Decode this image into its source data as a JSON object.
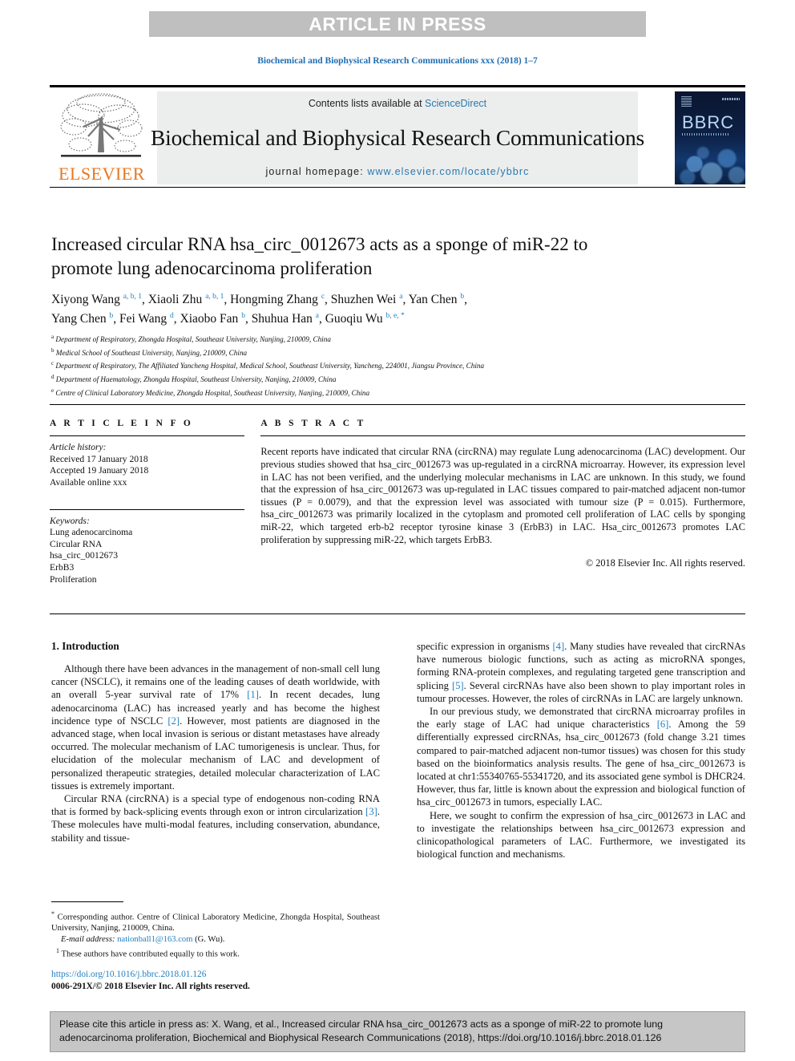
{
  "banner": {
    "text": "ARTICLE IN PRESS"
  },
  "running_head": "Biochemical and Biophysical Research Communications xxx (2018) 1–7",
  "journal_header": {
    "contents_prefix": "Contents lists available at ",
    "sciencedirect": "ScienceDirect",
    "journal_title": "Biochemical and Biophysical Research Communications",
    "homepage_prefix": "journal homepage: ",
    "homepage_url": "www.elsevier.com/locate/ybbrc",
    "elsevier_wordmark": "ELSEVIER",
    "cover_wordmark": "BBRC",
    "accent_link_color": "#2a7ab0",
    "elsevier_orange": "#e87722"
  },
  "article": {
    "title": "Increased circular RNA hsa_circ_0012673 acts as a sponge of miR-22 to promote lung adenocarcinoma proliferation",
    "authors_line_1": "Xiyong Wang ",
    "authors": [
      {
        "name": "Xiyong Wang",
        "marks": "a, b, 1"
      },
      {
        "name": "Xiaoli Zhu",
        "marks": "a, b, 1"
      },
      {
        "name": "Hongming Zhang",
        "marks": "c"
      },
      {
        "name": "Shuzhen Wei",
        "marks": "a"
      },
      {
        "name": "Yan Chen",
        "marks": "b"
      },
      {
        "name": "Yang Chen",
        "marks": "b"
      },
      {
        "name": "Fei Wang",
        "marks": "d"
      },
      {
        "name": "Xiaobo Fan",
        "marks": "b"
      },
      {
        "name": "Shuhua Han",
        "marks": "a"
      },
      {
        "name": "Guoqiu Wu",
        "marks": "b, e, *"
      }
    ],
    "affiliations": [
      {
        "label": "a",
        "text": "Department of Respiratory, Zhongda Hospital, Southeast University, Nanjing, 210009, China"
      },
      {
        "label": "b",
        "text": "Medical School of Southeast University, Nanjing, 210009, China"
      },
      {
        "label": "c",
        "text": "Department of Respiratory, The Affiliated Yancheng Hospital, Medical School, Southeast University, Yancheng, 224001, Jiangsu Province, China"
      },
      {
        "label": "d",
        "text": "Department of Haematology, Zhongda Hospital, Southeast University, Nanjing, 210009, China"
      },
      {
        "label": "e",
        "text": "Centre of Clinical Laboratory Medicine, Zhongda Hospital, Southeast University, Nanjing, 210009, China"
      }
    ]
  },
  "article_info": {
    "heading": "A R T I C L E  I N F O",
    "history_label": "Article history:",
    "history": [
      "Received 17 January 2018",
      "Accepted 19 January 2018",
      "Available online xxx"
    ],
    "keywords_label": "Keywords:",
    "keywords": [
      "Lung adenocarcinoma",
      "Circular RNA",
      "hsa_circ_0012673",
      "ErbB3",
      "Proliferation"
    ]
  },
  "abstract": {
    "heading": "A B S T R A C T",
    "body": "Recent reports have indicated that circular RNA (circRNA) may regulate Lung adenocarcinoma (LAC) development. Our previous studies showed that hsa_circ_0012673 was up-regulated in a circRNA microarray. However, its expression level in LAC has not been verified, and the underlying molecular mechanisms in LAC are unknown. In this study, we found that the expression of hsa_circ_0012673 was up-regulated in LAC tissues compared to pair-matched adjacent non-tumor tissues (P = 0.0079), and that the expression level was associated with tumour size (P = 0.015). Furthermore, hsa_circ_0012673 was primarily localized in the cytoplasm and promoted cell proliferation of LAC cells by sponging miR-22, which targeted erb-b2 receptor tyrosine kinase 3 (ErbB3) in LAC. Hsa_circ_0012673 promotes LAC proliferation by suppressing miR-22, which targets ErbB3.",
    "copyright": "© 2018 Elsevier Inc. All rights reserved."
  },
  "introduction": {
    "heading": "1. Introduction",
    "left_paragraphs": [
      "Although there have been advances in the management of non-small cell lung cancer (NSCLC), it remains one of the leading causes of death worldwide, with an overall 5-year survival rate of 17% [1]. In recent decades, lung adenocarcinoma (LAC) has increased yearly and has become the highest incidence type of NSCLC [2]. However, most patients are diagnosed in the advanced stage, when local invasion is serious or distant metastases have already occurred. The molecular mechanism of LAC tumorigenesis is unclear. Thus, for elucidation of the molecular mechanism of LAC and development of personalized therapeutic strategies, detailed molecular characterization of LAC tissues is extremely important.",
      "Circular RNA (circRNA) is a special type of endogenous non-coding RNA that is formed by back-splicing events through exon or intron circularization [3]. These molecules have multi-modal features, including conservation, abundance, stability and tissue-"
    ],
    "right_paragraphs": [
      "specific expression in organisms [4]. Many studies have revealed that circRNAs have numerous biologic functions, such as acting as microRNA sponges, forming RNA-protein complexes, and regulating targeted gene transcription and splicing [5]. Several circRNAs have also been shown to play important roles in tumour processes. However, the roles of circRNAs in LAC are largely unknown.",
      "In our previous study, we demonstrated that circRNA microarray profiles in the early stage of LAC had unique characteristics [6]. Among the 59 differentially expressed circRNAs, hsa_circ_0012673 (fold change 3.21 times compared to pair-matched adjacent non-tumor tissues) was chosen for this study based on the bioinformatics analysis results. The gene of hsa_circ_0012673 is located at chr1:55340765-55341720, and its associated gene symbol is DHCR24. However, thus far, little is known about the expression and biological function of hsa_circ_0012673 in tumors, especially LAC.",
      "Here, we sought to confirm the expression of hsa_circ_0012673 in LAC and to investigate the relationships between hsa_circ_0012673 expression and clinicopathological parameters of LAC. Furthermore, we investigated its biological function and mechanisms."
    ]
  },
  "footnotes": {
    "corresponding": "Corresponding author. Centre of Clinical Laboratory Medicine, Zhongda Hospital, Southeast University, Nanjing, 210009, China.",
    "corresponding_mark": "*",
    "email_label": "E-mail address:",
    "email": "nationball1@163.com",
    "email_suffix": "(G. Wu).",
    "equal_mark": "1",
    "equal_contrib": "These authors have contributed equally to this work."
  },
  "footer": {
    "doi": "https://doi.org/10.1016/j.bbrc.2018.01.126",
    "issn_line": "0006-291X/© 2018 Elsevier Inc. All rights reserved."
  },
  "cite_box": {
    "text": "Please cite this article in press as: X. Wang, et al., Increased circular RNA hsa_circ_0012673 acts as a sponge of miR-22 to promote lung adenocarcinoma proliferation, Biochemical and Biophysical Research Communications (2018), https://doi.org/10.1016/j.bbrc.2018.01.126"
  }
}
